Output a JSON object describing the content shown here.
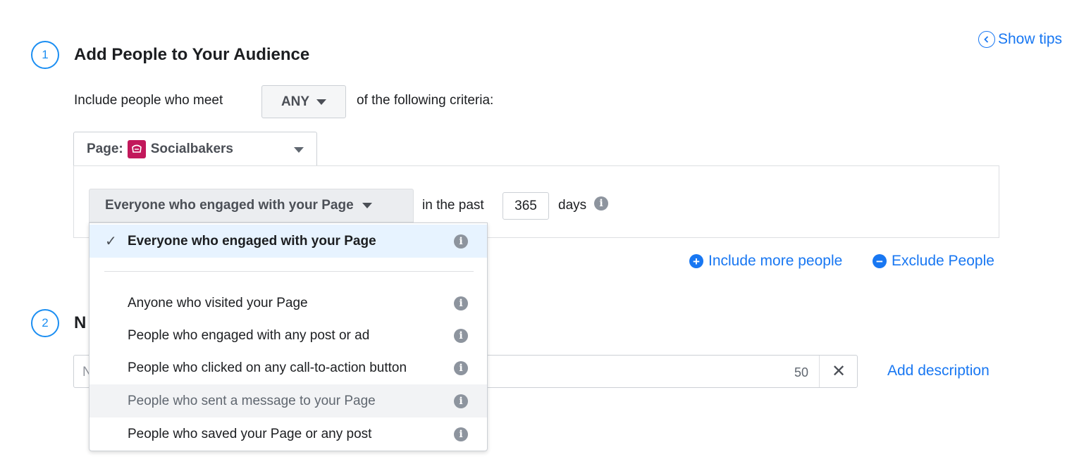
{
  "header": {
    "show_tips": "Show tips"
  },
  "step1": {
    "number": "1",
    "title": "Add People to Your Audience",
    "include_prefix": "Include people who meet",
    "match_value": "ANY",
    "include_suffix": "of the following criteria:",
    "page_label": "Page:",
    "page_name": "Socialbakers",
    "engagement_selected": "Everyone who engaged with your Page",
    "in_the_past": "in the past",
    "days_value": "365",
    "days_label": "days"
  },
  "actions": {
    "include_more": "Include more people",
    "exclude": "Exclude People"
  },
  "step2": {
    "number": "2",
    "title_partial": "N",
    "name_placeholder": "N",
    "char_count": "50",
    "add_description": "Add description"
  },
  "dropdown": {
    "selected": "Everyone who engaged with your Page",
    "options": [
      "Anyone who visited your Page",
      "People who engaged with any post or ad",
      "People who clicked on any call-to-action button",
      "People who sent a message to your Page",
      "People who saved your Page or any post"
    ]
  },
  "colors": {
    "accent": "#1877f2",
    "step_circle": "#1b8ef2",
    "page_logo": "#c2185b",
    "selected_bg": "#e7f3ff"
  }
}
